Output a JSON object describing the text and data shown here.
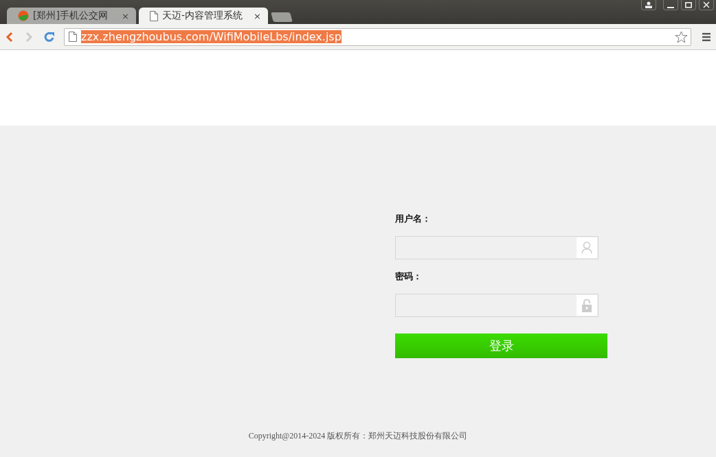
{
  "browser": {
    "tabs": [
      {
        "title": "[郑州]手机公交网",
        "kind": "logo",
        "selected": false,
        "close": "×"
      },
      {
        "title": "天迈-内容管理系统",
        "kind": "page",
        "selected": true,
        "close": "×"
      }
    ],
    "address": {
      "url": "zzx.zhengzhoubus.com/WifiMobileLbs/index.jsp",
      "selected": true
    }
  },
  "login": {
    "fields": [
      {
        "label": "用户名：",
        "kind": "user"
      },
      {
        "label": "密码：",
        "kind": "password"
      }
    ],
    "button": "登录"
  },
  "footer": "Copyright@2014-2024 版权所有：郑州天迈科技股份有限公司"
}
